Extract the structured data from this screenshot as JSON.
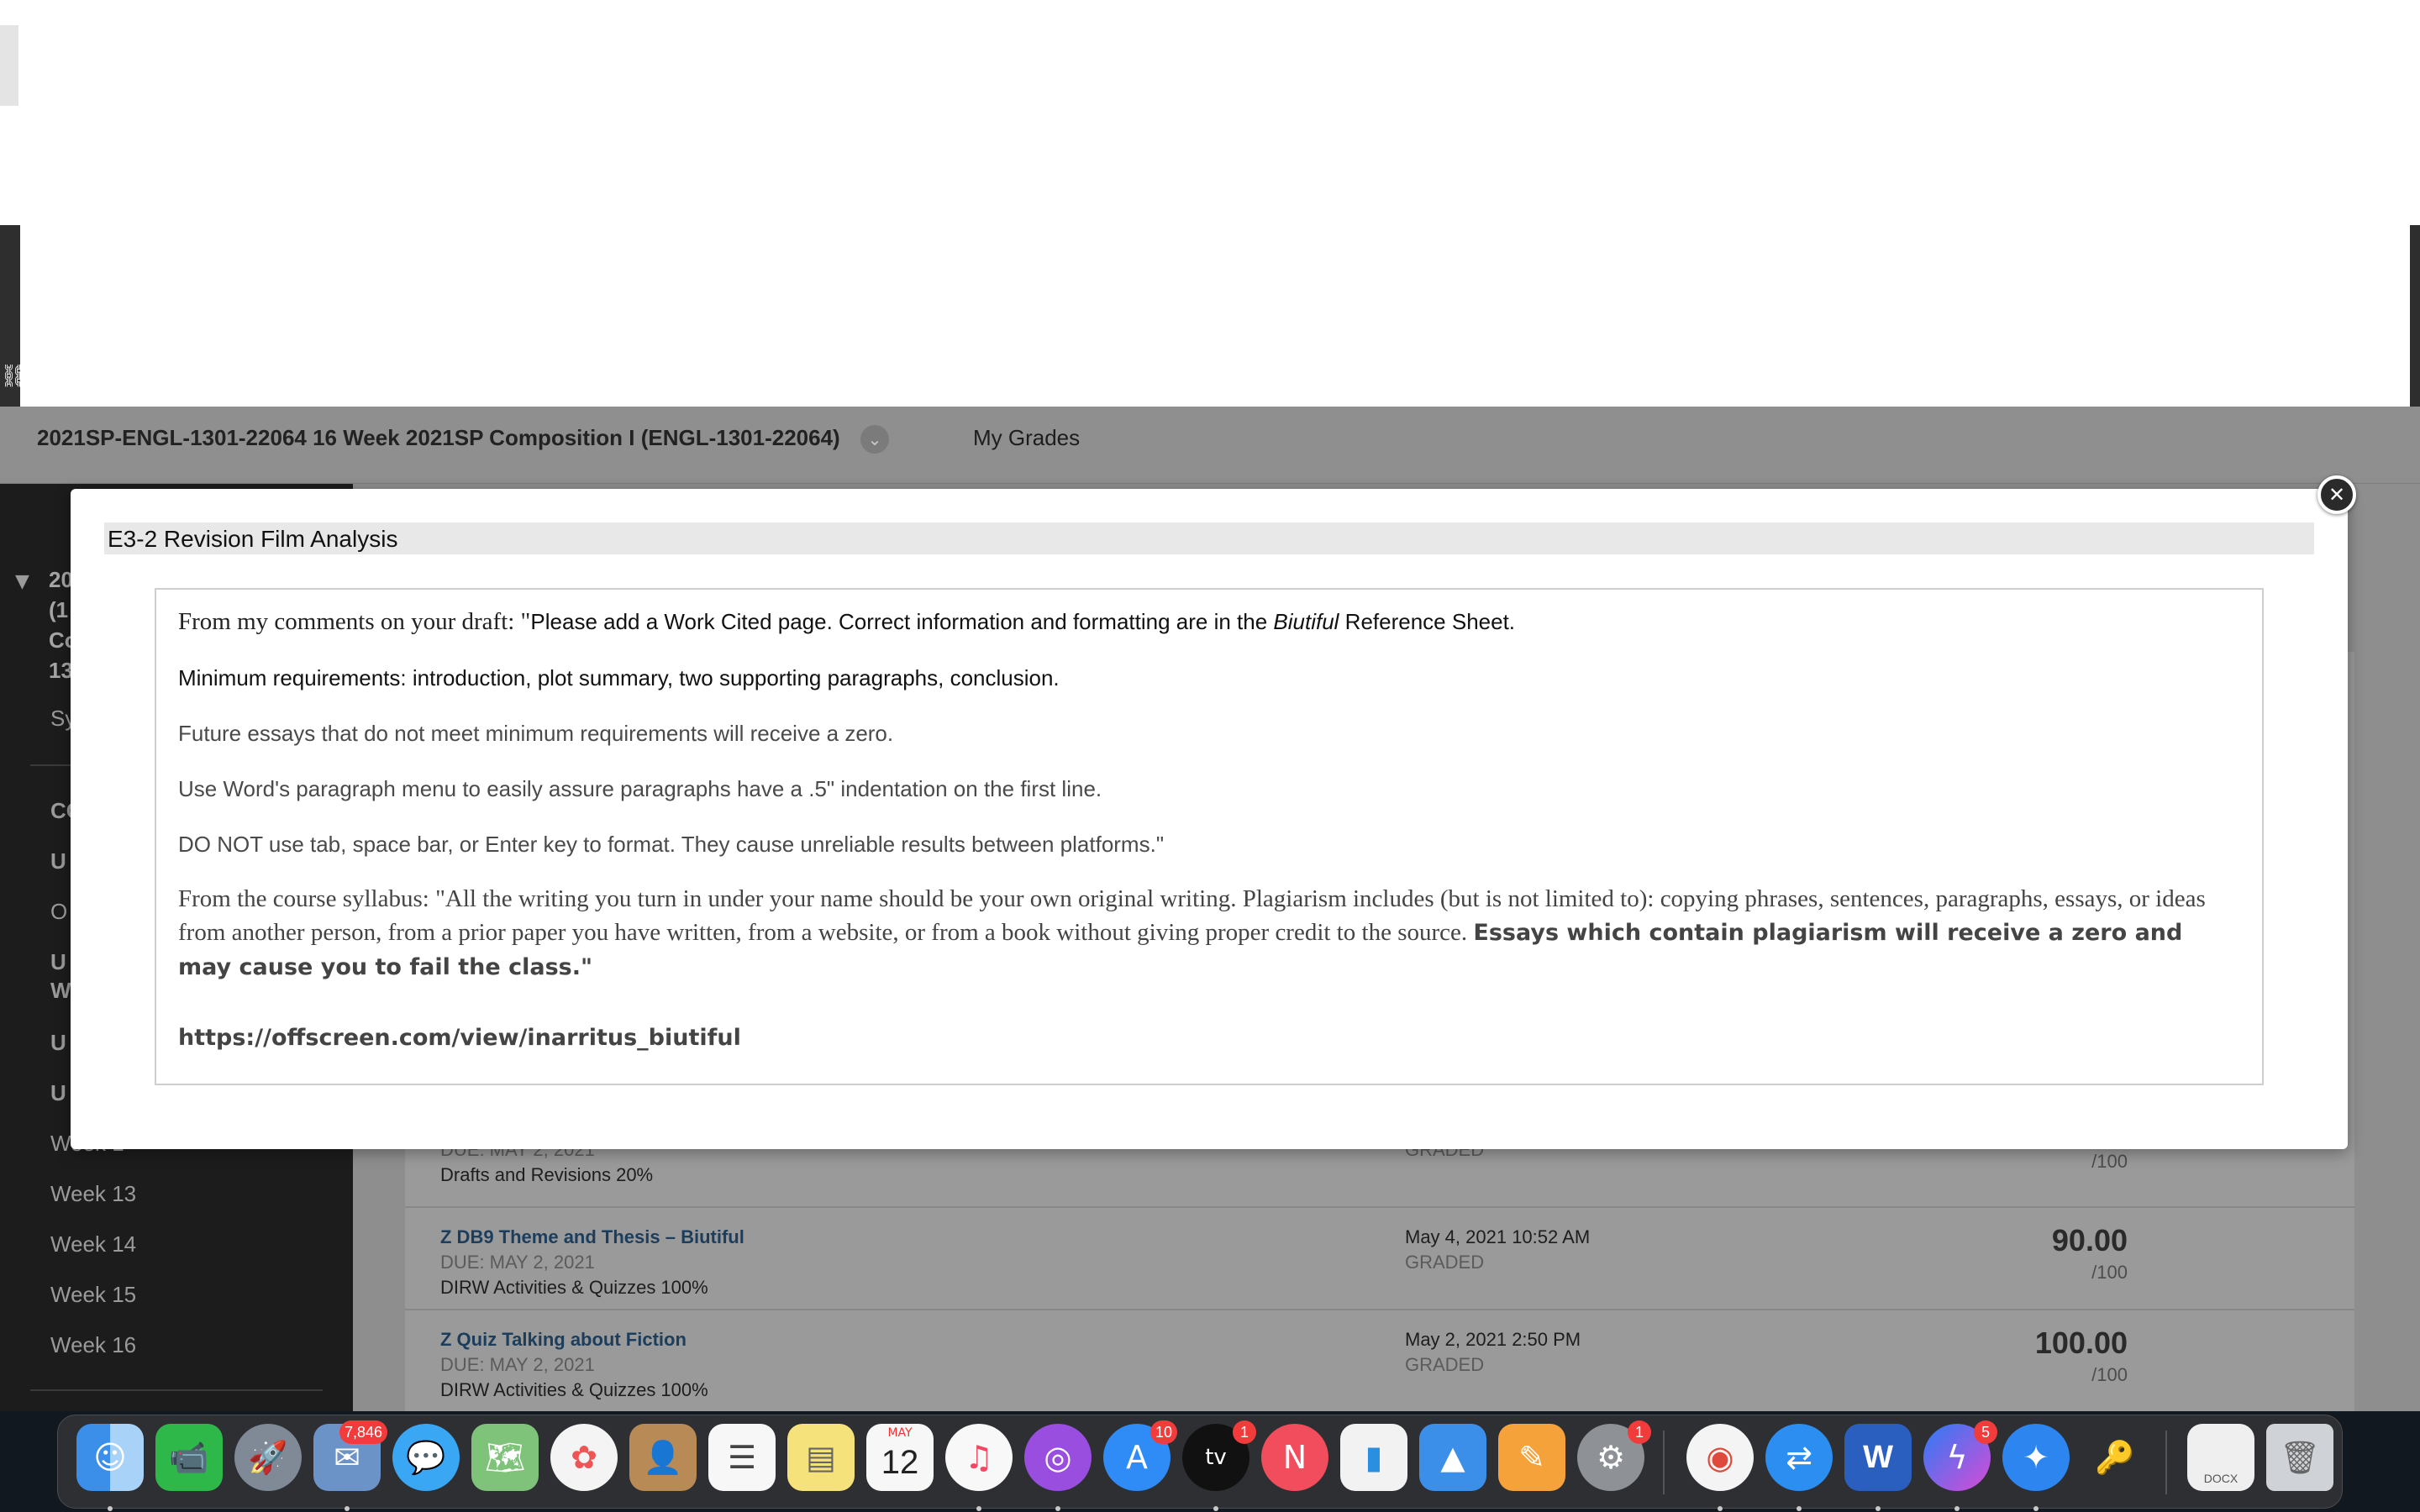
{
  "course_bar": {
    "title": "2021SP-ENGL-1301-22064 16 Week 2021SP Composition I (ENGL-1301-22064)",
    "my_grades": "My Grades"
  },
  "sidebar": {
    "course_abbrev": "20(1Co13",
    "items": {
      "sy": "Sy",
      "co": "CO",
      "u1": "U",
      "o": "O",
      "u2": "U",
      "w": "W",
      "u3": "U",
      "u4": "U",
      "week_partial": "Week 1",
      "week13": "Week 13",
      "week14": "Week 14",
      "week15": "Week 15",
      "week16": "Week 16"
    }
  },
  "grades": [
    {
      "due": "DUE: MAY 2, 2021",
      "category": "Drafts and Revisions 20%",
      "status": "GRADED",
      "out_of": "/100"
    },
    {
      "title": "Z DB9 Theme and Thesis – Biutiful",
      "due": "DUE: MAY 2, 2021",
      "category": "DIRW Activities & Quizzes 100%",
      "date": "May 4, 2021 10:52 AM",
      "status": "GRADED",
      "score": "90.00",
      "out_of": "/100"
    },
    {
      "title": "Z Quiz Talking about Fiction",
      "due": "DUE: MAY 2, 2021",
      "category": "DIRW Activities & Quizzes 100%",
      "date": "May 2, 2021 2:50 PM",
      "status": "GRADED",
      "score": "100.00",
      "out_of": "/100"
    }
  ],
  "modal": {
    "title": "E3-2 Revision Film Analysis",
    "close_label": "✕",
    "p1_lead": "From my comments on your draft: \"",
    "p1_mid": "Please add a Work Cited page. Correct information and formatting are in the ",
    "p1_italic": "Biutiful",
    "p1_end": " Reference Sheet.",
    "p2": "Minimum requirements: introduction, plot summary, two supporting paragraphs, conclusion.",
    "p3": "Future essays that do not meet minimum requirements will receive a zero.",
    "p4": "Use Word's paragraph menu to easily assure paragraphs have a .5\" indentation on the first line.",
    "p5": "DO NOT use tab, space bar, or Enter key to format. They cause unreliable results between platforms.\"",
    "p6_regular": "From the course syllabus: \"All the writing you turn in under your name should be your own original writing. Plagiarism includes (but is not limited to): copying phrases, sentences, paragraphs, essays, or ideas from another person, from a prior paper you have written, from a website, or from a book without giving proper credit to the source. ",
    "p6_bold": "Essays which contain plagiarism will receive a zero and may cause you to fail the class.\"",
    "link": "https://offscreen.com/view/inarritus_biutiful"
  },
  "dock": {
    "calendar_month": "MAY",
    "calendar_day": "12",
    "mail_badge": "7,846",
    "appstore_badge": "10",
    "tv_badge": "1",
    "tv_label": "tv",
    "prefs_badge": "1",
    "messenger_badge": "5",
    "word_label": "W",
    "docx_label": "DOCX"
  },
  "colors": {
    "accent_link": "#1c3d5c",
    "badge_red": "#f23c3c",
    "sidebar_bg": "#1c1c1c",
    "modal_title_bg": "#e8e8e8"
  }
}
